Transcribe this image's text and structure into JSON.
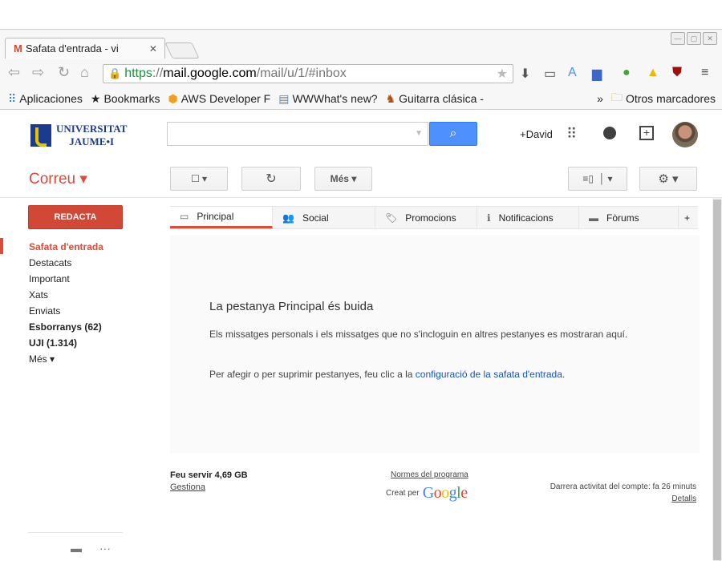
{
  "browser": {
    "tab_title": "Safata d'entrada - vi",
    "url_https": "https",
    "url_sep": "://",
    "url_host": "mail.google.com",
    "url_path": "/mail/u/1/#inbox",
    "bookmarks": [
      "Aplicaciones",
      "Bookmarks",
      "AWS Developer F",
      "WWWhat's new?",
      "Guitarra clásica -",
      "»",
      "Otros marcadores"
    ]
  },
  "header": {
    "logo_line1": "UNIVERSITAT",
    "logo_line2": "JAUME•I",
    "search_value": "",
    "plus_user": "+David"
  },
  "toolbar": {
    "correu_label": "Correu ▾",
    "mes_label": "Més ▾"
  },
  "sidebar": {
    "compose_label": "REDACTA",
    "items": [
      "Safata d'entrada",
      "Destacats",
      "Important",
      "Xats",
      "Enviats",
      "Esborranys (62)",
      "UJI (1.314)",
      "Més ▾"
    ]
  },
  "inbox_tabs": [
    "Principal",
    "Social",
    "Promocions",
    "Notificacions",
    "Fòrums"
  ],
  "empty": {
    "title": "La pestanya Principal és buida",
    "desc": "Els missatges personals i els missatges que no s'incloguin en altres pestanyes es mostraran aquí.",
    "hint_prefix": "Per afegir o per suprimir pestanyes, feu clic a la",
    "hint_link": "configuració de la safata d'entrada",
    "hint_suffix": "."
  },
  "footer": {
    "storage": "Feu servir 4,69 GB",
    "manage": "Gestiona",
    "policy": "Normes del programa",
    "powered_by": "Creat per",
    "google": "Google",
    "activity": "Darrera activitat del compte: fa 26 minuts",
    "details": "Detalls"
  },
  "colors": {
    "accent": "#dd4b39",
    "blue": "#4d90fe",
    "link": "#15c"
  }
}
